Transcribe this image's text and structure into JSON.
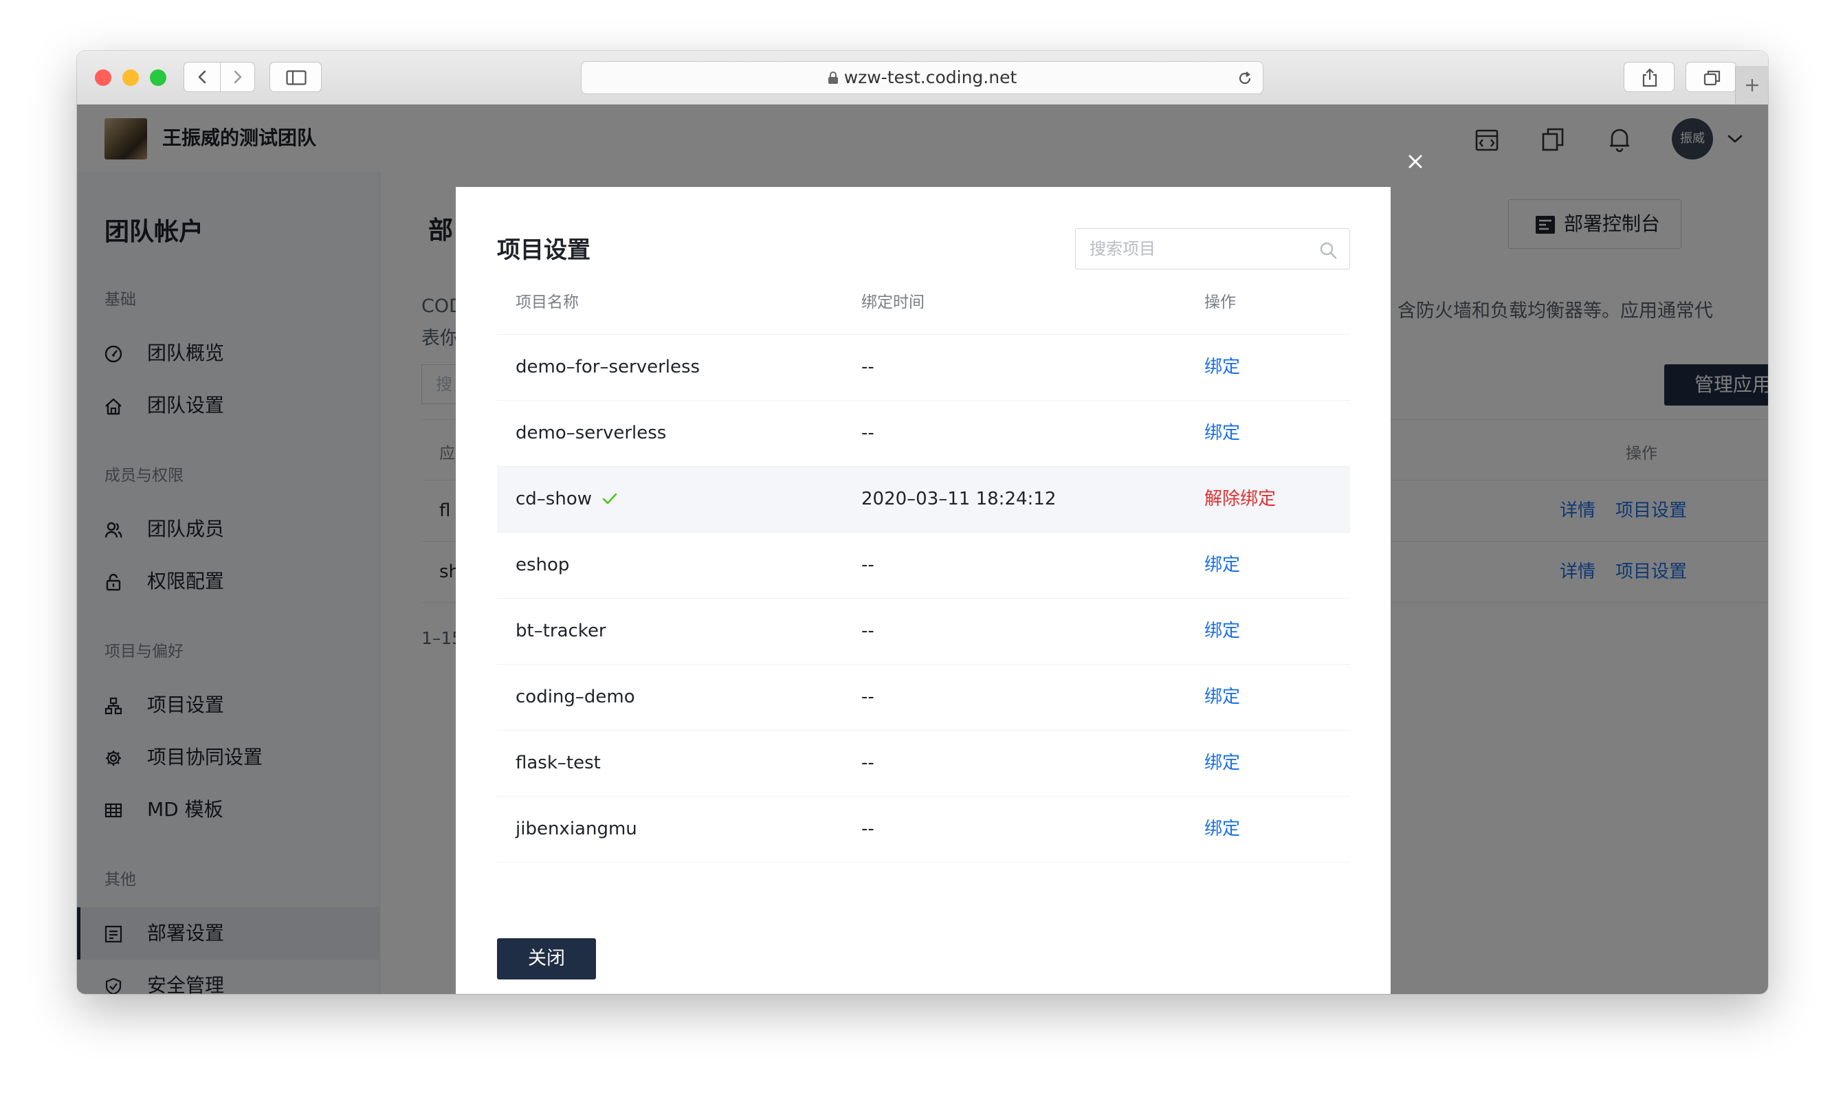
{
  "browser": {
    "url": "wzw-test.coding.net",
    "colors": {
      "close": "#ff5f57",
      "minimize": "#febc2e",
      "zoom": "#28c840"
    },
    "icons": [
      "back-icon",
      "forward-icon",
      "sidebar-toggle-icon",
      "lock-icon",
      "reload-icon",
      "share-icon",
      "tabs-icon",
      "new-tab-icon"
    ]
  },
  "header": {
    "team_name": "王振威的测试团队",
    "avatar_text": "振威",
    "icons": [
      "dashboard-icon",
      "copy-icon",
      "bell-icon",
      "chevron-down-icon"
    ]
  },
  "sidebar": {
    "title": "团队帐户",
    "groups": [
      {
        "label": "基础",
        "items": [
          {
            "label": "团队概览",
            "icon": "gauge-icon"
          },
          {
            "label": "团队设置",
            "icon": "home-icon"
          }
        ]
      },
      {
        "label": "成员与权限",
        "items": [
          {
            "label": "团队成员",
            "icon": "members-icon"
          },
          {
            "label": "权限配置",
            "icon": "lock-icon"
          }
        ]
      },
      {
        "label": "项目与偏好",
        "items": [
          {
            "label": "项目设置",
            "icon": "hierarchy-icon"
          },
          {
            "label": "项目协同设置",
            "icon": "gear-icon"
          },
          {
            "label": "MD 模板",
            "icon": "grid-icon"
          }
        ]
      },
      {
        "label": "其他",
        "items": [
          {
            "label": "部署设置",
            "icon": "deploy-icon",
            "active": true
          },
          {
            "label": "安全管理",
            "icon": "shield-icon"
          }
        ]
      }
    ]
  },
  "main": {
    "title_partial": "部",
    "deploy_console_button": "部署控制台",
    "desc_left_line1": "COD",
    "desc_left_line2": "表你",
    "desc_right": "含防火墙和负载均衡器等。应用通常代",
    "search_partial": "搜",
    "manage_app_button": "管理应用",
    "col_partial": "应",
    "col_op": "操作",
    "rows": [
      {
        "name_partial": "fl",
        "detail": "详情",
        "settings": "项目设置"
      },
      {
        "name_partial": "sh",
        "detail": "详情",
        "settings": "项目设置"
      }
    ],
    "pagination_partial": "1–15"
  },
  "modal": {
    "title": "项目设置",
    "search_placeholder": "搜索项目",
    "columns": {
      "name": "项目名称",
      "time": "绑定时间",
      "op": "操作"
    },
    "rows": [
      {
        "name": "demo–for–serverless",
        "time": "--",
        "op": "绑定",
        "bound": false
      },
      {
        "name": "demo–serverless",
        "time": "--",
        "op": "绑定",
        "bound": false
      },
      {
        "name": "cd–show",
        "time": "2020–03–11 18:24:12",
        "op": "解除绑定",
        "bound": true
      },
      {
        "name": "eshop",
        "time": "--",
        "op": "绑定",
        "bound": false
      },
      {
        "name": "bt–tracker",
        "time": "--",
        "op": "绑定",
        "bound": false
      },
      {
        "name": "coding–demo",
        "time": "--",
        "op": "绑定",
        "bound": false
      },
      {
        "name": "flask–test",
        "time": "--",
        "op": "绑定",
        "bound": false
      },
      {
        "name": "jibenxiangmu",
        "time": "--",
        "op": "绑定",
        "bound": false
      }
    ],
    "close_button": "关闭",
    "colors": {
      "link": "#1b6fe6",
      "danger": "#e03131",
      "check": "#52c41a",
      "primary": "#1f2d45"
    }
  }
}
